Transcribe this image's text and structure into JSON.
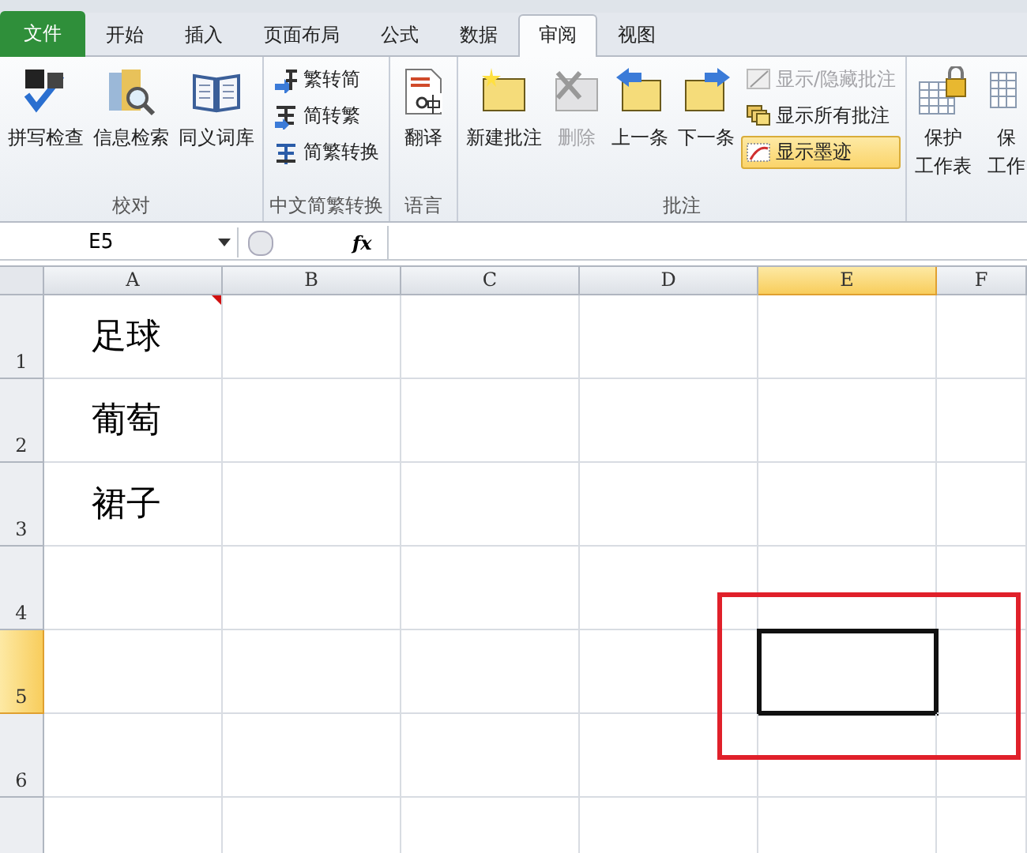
{
  "tabs": [
    {
      "label": "文件",
      "kind": "file",
      "selected": false
    },
    {
      "label": "开始",
      "kind": "tab",
      "selected": false
    },
    {
      "label": "插入",
      "kind": "tab",
      "selected": false
    },
    {
      "label": "页面布局",
      "kind": "tab",
      "selected": false
    },
    {
      "label": "公式",
      "kind": "tab",
      "selected": false
    },
    {
      "label": "数据",
      "kind": "tab",
      "selected": false
    },
    {
      "label": "审阅",
      "kind": "tab",
      "selected": true
    },
    {
      "label": "视图",
      "kind": "tab",
      "selected": false
    }
  ],
  "ribbon": {
    "groups": [
      {
        "label": "校对",
        "items": [
          {
            "lines": [
              "拼写检查"
            ],
            "kind": "large",
            "disabled": false
          },
          {
            "lines": [
              "信息检索"
            ],
            "kind": "large",
            "disabled": false
          },
          {
            "lines": [
              "同义词库"
            ],
            "kind": "large",
            "disabled": false
          }
        ]
      },
      {
        "label": "中文简繁转换",
        "items": [
          {
            "lines": [
              "繁转简"
            ],
            "kind": "small",
            "disabled": false,
            "selected": false
          },
          {
            "lines": [
              "简转繁"
            ],
            "kind": "small",
            "disabled": false,
            "selected": false
          },
          {
            "lines": [
              "简繁转换"
            ],
            "kind": "small",
            "disabled": false,
            "selected": false
          }
        ]
      },
      {
        "label": "语言",
        "items": [
          {
            "lines": [
              "翻译"
            ],
            "kind": "large",
            "disabled": false
          }
        ]
      },
      {
        "label": "批注",
        "items": [
          {
            "lines": [
              "新建批注"
            ],
            "kind": "large",
            "disabled": false
          },
          {
            "lines": [
              "删除"
            ],
            "kind": "large",
            "disabled": true
          },
          {
            "lines": [
              "上一条"
            ],
            "kind": "large",
            "disabled": false
          },
          {
            "lines": [
              "下一条"
            ],
            "kind": "large",
            "disabled": false
          },
          {
            "lines": [
              "显示/隐藏批注"
            ],
            "kind": "small",
            "disabled": true,
            "selected": false
          },
          {
            "lines": [
              "显示所有批注"
            ],
            "kind": "small",
            "disabled": false,
            "selected": false
          },
          {
            "lines": [
              "显示墨迹"
            ],
            "kind": "small",
            "disabled": false,
            "selected": true
          }
        ]
      },
      {
        "items": [
          {
            "lines": [
              "保护",
              "工作表"
            ],
            "kind": "large",
            "disabled": false
          },
          {
            "lines": [
              "保",
              "工作"
            ],
            "kind": "large",
            "disabled": false
          }
        ]
      }
    ]
  },
  "name_box": "E5",
  "fx": "fx",
  "columns": [
    {
      "label": "A",
      "selected": false
    },
    {
      "label": "B",
      "selected": false
    },
    {
      "label": "C",
      "selected": false
    },
    {
      "label": "D",
      "selected": false
    },
    {
      "label": "E",
      "selected": true
    },
    {
      "label": "F",
      "selected": false
    }
  ],
  "rows": [
    {
      "label": "1",
      "selected": false,
      "cells": [
        {
          "text": "足球",
          "has_comment": true,
          "selected": false
        },
        {
          "selected": false
        },
        {
          "selected": false
        },
        {
          "selected": false
        },
        {
          "selected": false
        },
        {
          "selected": false
        }
      ]
    },
    {
      "label": "2",
      "selected": false,
      "cells": [
        {
          "text": "葡萄",
          "has_comment": false,
          "selected": false
        },
        {
          "selected": false
        },
        {
          "selected": false
        },
        {
          "selected": false
        },
        {
          "selected": false
        },
        {
          "selected": false
        }
      ]
    },
    {
      "label": "3",
      "selected": false,
      "cells": [
        {
          "text": "裙子",
          "has_comment": false,
          "selected": false
        },
        {
          "selected": false
        },
        {
          "selected": false
        },
        {
          "selected": false
        },
        {
          "selected": false
        },
        {
          "selected": false
        }
      ]
    },
    {
      "label": "4",
      "selected": false,
      "cells": [
        {
          "selected": false
        },
        {
          "selected": false
        },
        {
          "selected": false
        },
        {
          "selected": false
        },
        {
          "selected": false
        },
        {
          "selected": false
        }
      ]
    },
    {
      "label": "5",
      "selected": true,
      "cells": [
        {
          "selected": false
        },
        {
          "selected": false
        },
        {
          "selected": false
        },
        {
          "selected": false
        },
        {
          "selected": true
        },
        {
          "selected": false
        }
      ]
    },
    {
      "label": "6",
      "selected": false,
      "cells": [
        {
          "selected": false
        },
        {
          "selected": false
        },
        {
          "selected": false
        },
        {
          "selected": false
        },
        {
          "selected": false
        },
        {
          "selected": false
        }
      ]
    },
    {
      "selected": false,
      "cells": [
        {
          "selected": false
        },
        {
          "selected": false
        },
        {
          "selected": false
        },
        {
          "selected": false
        },
        {
          "selected": false
        },
        {
          "selected": false
        }
      ]
    }
  ]
}
